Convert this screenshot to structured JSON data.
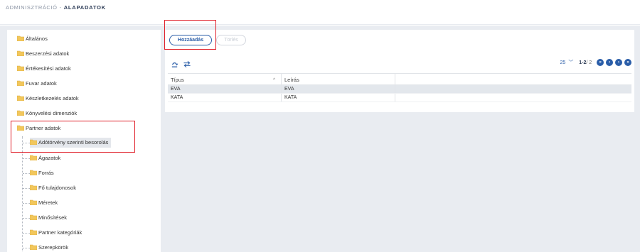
{
  "breadcrumb": {
    "section": "ADMINISZTRÁCIÓ",
    "separator": "-",
    "current": "ALAPADATOK"
  },
  "tree": {
    "items": [
      {
        "label": "Általános"
      },
      {
        "label": "Beszerzési adatok"
      },
      {
        "label": "Értékesítési adatok"
      },
      {
        "label": "Fuvar adatok"
      },
      {
        "label": "Készletkezelés adatok"
      },
      {
        "label": "Könyvelési dimenziók"
      },
      {
        "label": "Partner adatok"
      }
    ],
    "children": [
      {
        "label": "Adótörvény szerinti besorolás"
      },
      {
        "label": "Ágazatok"
      },
      {
        "label": "Forrás"
      },
      {
        "label": "Fő tulajdonosok"
      },
      {
        "label": "Méretek"
      },
      {
        "label": "Minősítések"
      },
      {
        "label": "Partner kategóriák"
      },
      {
        "label": "Szerepkörök"
      }
    ]
  },
  "toolbar": {
    "add_label": "Hozzáadás",
    "delete_label": "Törlés"
  },
  "tools": {
    "refresh_icon": "refresh-icon",
    "swap_icon": "swap-icon"
  },
  "pager": {
    "page_size": "25",
    "range": "1-2",
    "total": "/ 2"
  },
  "table": {
    "headers": [
      "Típus",
      "Leírás"
    ],
    "rows": [
      [
        "EVA",
        "EVA"
      ],
      [
        "KATA",
        "KATA"
      ]
    ]
  },
  "colors": {
    "accent": "#2a5da8",
    "highlight": "#e0202a",
    "folder": "#f2c75c"
  }
}
